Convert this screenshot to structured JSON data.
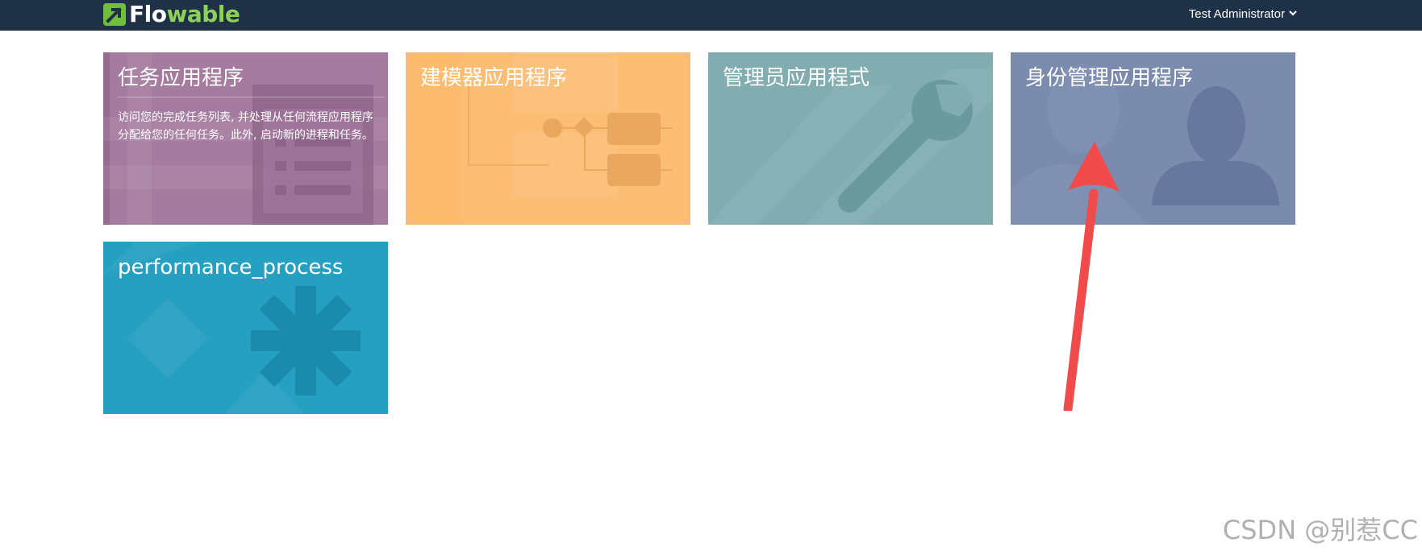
{
  "navbar": {
    "logo_text_main": "Flo",
    "logo_text_accent": "wable",
    "user_name": "Test Administrator",
    "user_menu_icon": "chevron-down-icon"
  },
  "tiles": [
    {
      "title": "任务应用程序",
      "description": "访问您的完成任务列表, 并处理从任何流程应用程序分配给您的任何任务。此外, 启动新的进程和任务。",
      "icon": "task-list-icon",
      "color": "#a57ca0"
    },
    {
      "title": "建模器应用程序",
      "icon": "process-diagram-icon",
      "color": "#fcbb6f"
    },
    {
      "title": "管理员应用程式",
      "icon": "wrench-icon",
      "color": "#81adb1"
    },
    {
      "title": "身份管理应用程序",
      "icon": "user-silhouette-icon",
      "color": "#7a8bae"
    },
    {
      "title": "performance_process",
      "icon": "asterisk-icon",
      "color": "#26a0c1"
    }
  ],
  "annotation": {
    "arrow_color": "#f04a4a"
  },
  "watermark": "CSDN @别惹CC"
}
